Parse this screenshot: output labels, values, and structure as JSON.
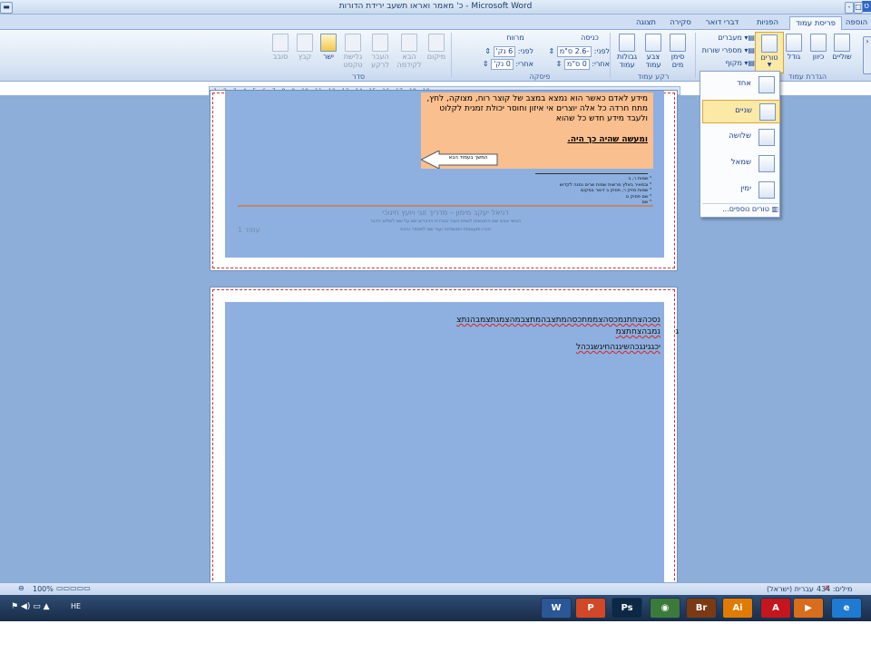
{
  "window": {
    "title": "כ' מאמר ואראו תשעב ירידת הדורות - Microsoft Word",
    "qat_badge": "ט"
  },
  "tabs": [
    {
      "label": "הוספה"
    },
    {
      "label": "פריסת עמוד",
      "active": true
    },
    {
      "label": "הפניות"
    },
    {
      "label": "דברי דואר"
    },
    {
      "label": "סקירה"
    },
    {
      "label": "תצוגה"
    }
  ],
  "ribbon": {
    "group_labels": {
      "page_setup": "הגדרת עמוד",
      "page_background": "רקע עמוד",
      "paragraph": "פיסקה",
      "arrange": "סדר"
    },
    "page_setup": {
      "columns": "טורים",
      "size": "גודל",
      "orientation": "כיוון",
      "margins": "שוליים",
      "breaks": "מעברים",
      "line_numbers": "מספרי שורות",
      "hyphenation": "מקוף"
    },
    "page_background": {
      "watermark": "סימן מים",
      "page_color": "צבע עמוד",
      "page_borders": "גבולות עמוד"
    },
    "paragraph": {
      "indent_title": "כניסה",
      "spacing_title": "מרווח",
      "indent_left_label": "לפני:",
      "indent_left_value": "-2.6 ס\"מ",
      "indent_right_label": "אחרי:",
      "indent_right_value": "0 ס\"מ",
      "spacing_before_label": "לפני:",
      "spacing_before_value": "6 נק'",
      "spacing_after_label": "אחרי:",
      "spacing_after_value": "0 נק'"
    },
    "arrange": {
      "position": "מיקום",
      "bring_front": "הבא לקידמה",
      "send_back": "העבר לרקע",
      "text_wrap": "גלישת טקסט",
      "align": "ישר",
      "group": "קבץ",
      "rotate": "סובב"
    }
  },
  "ruler": {
    "text": "· 1 · 2 · 3 · 4 · 5 · 6 · 7 · 8 · 9 · 10 · 11 · 12 · 13 · 14 · 15 · 16 · 17 · 18 · 19 · "
  },
  "columns_menu": {
    "items": [
      {
        "label": "אחד"
      },
      {
        "label": "שניים",
        "selected": true
      },
      {
        "label": "שלושה"
      },
      {
        "label": "שמאל"
      },
      {
        "label": "ימין"
      }
    ],
    "more": "טורים נוספים..."
  },
  "document": {
    "page1": {
      "callout_text": "מידע לאדם כאשר הוא נמצא במצב של קוצר רוח, מצוקה, לחץ, מתח חרדה כל אלה יוצרים אי איזון וחוסר יכולת זמנית לקלוט ולעבד מידע חדש כל שהוא",
      "callout_bold": "ומעשה שהיה כך היה.",
      "arrow_label": "המשך בעמוד הבא",
      "footnotes": [
        "¹ שמות ר, ב",
        "² ובמאיר באלץ מרשות שמות שרים נמנה לקדוש",
        "³ שמות מזיק ר, פסוק ב דואר במקום",
        "⁴ שם פסוק ט",
        "⁵ שם"
      ],
      "footer_author": "דניאל יעקב מימון – מדריך זוגי ויועץ חינוכי",
      "footer_line2": "הגושי אביב שם התנגשות לשפת גיבור ובגדרת הדברים שם על שם לשלוט הדבר",
      "footer_line3": "הגרו ומעצמות המשפחה ועוד שם למספר והבת",
      "page_number": "עמוד 1"
    },
    "page2": {
      "line1": "נסכהצחתנמכסהצממתכסהמתצבהמתצבמהצמגתצמבהנתצ",
      "line1b": "ג",
      "line2": "נמבהצחתצמ",
      "line3": "יכגגינגכהשיגנהחיגשגכהל"
    }
  },
  "statusbar": {
    "words": "מילים: 434",
    "language": "עברית (ישראל)",
    "zoom": "100%"
  },
  "taskbar": {
    "lang": "HE",
    "apps": [
      {
        "name": "word",
        "label": "W",
        "color": "#2b5797"
      },
      {
        "name": "powerpoint",
        "label": "P",
        "color": "#d24726"
      },
      {
        "name": "photoshop",
        "label": "Ps",
        "color": "#0b2845"
      },
      {
        "name": "chrome",
        "label": "◉",
        "color": "#3c7a3c"
      },
      {
        "name": "bridge",
        "label": "Br",
        "color": "#7a3a14"
      },
      {
        "name": "illustrator",
        "label": "Ai",
        "color": "#e07b00"
      },
      {
        "name": "acrobat",
        "label": "A",
        "color": "#c4161c"
      },
      {
        "name": "media-player",
        "label": "▶",
        "color": "#d86d1b"
      },
      {
        "name": "internet-explorer",
        "label": "e",
        "color": "#1f7bd1"
      }
    ]
  }
}
